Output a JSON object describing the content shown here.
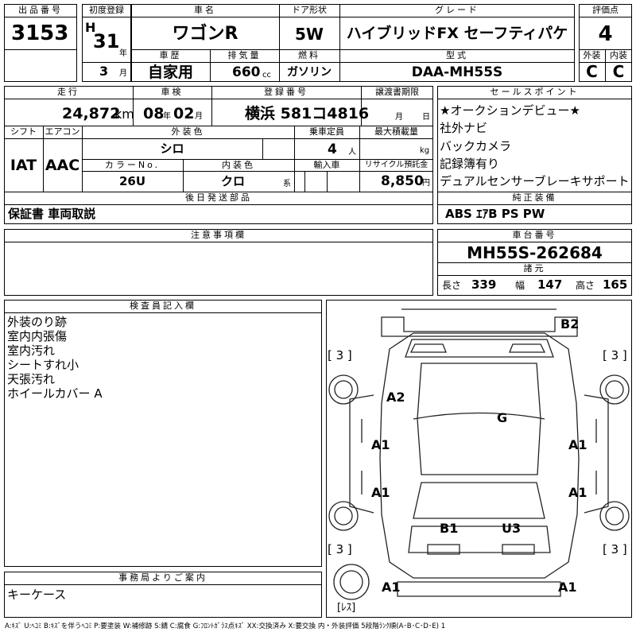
{
  "header": {
    "lot_no_label": "出品番号",
    "lot_no": "3153",
    "first_reg_label": "初度登録",
    "era": "H",
    "year": "31",
    "year_unit": "年",
    "month": "3",
    "month_unit": "月",
    "car_name_label": "車名",
    "car_name": "ワゴンR",
    "door_label": "ドア形状",
    "door": "5W",
    "grade_label": "グレード",
    "grade": "ハイブリッドFX セーフティパケ",
    "score_label": "評価点",
    "score": "4",
    "history_label": "車歴",
    "history": "自家用",
    "displacement_label": "排気量",
    "displacement": "660",
    "displacement_unit": "cc",
    "fuel_label": "燃料",
    "fuel": "ガソリン",
    "model_label": "型式",
    "model": "DAA-MH55S",
    "ext_label": "外装",
    "int_label": "内装",
    "ext_grade": "C",
    "int_grade": "C"
  },
  "row2": {
    "mileage_label": "走行",
    "mileage": "24,872",
    "mileage_unit": "km",
    "inspection_label": "車検",
    "insp_year": "08",
    "insp_year_unit": "年",
    "insp_month": "02",
    "insp_month_unit": "月",
    "plate_label": "登録番号",
    "plate": "横浜 581コ4816",
    "transfer_label": "譲渡書期限",
    "transfer_month_unit": "月",
    "transfer_day_unit": "日",
    "shift_label": "シフト",
    "shift": "IAT",
    "ac_label": "エアコン",
    "ac": "AAC",
    "color_label": "外装色",
    "color": "シロ",
    "capacity_label": "乗車定員",
    "capacity": "4",
    "capacity_unit": "人",
    "load_label": "最大積載量",
    "load_unit": "kg",
    "color_no_label": "カラーNo.",
    "color_no": "26U",
    "interior_color_label": "内装色",
    "interior_color": "クロ",
    "interior_color_unit": "系",
    "import_label": "輸入車",
    "recycle_label": "リサイクル預託金",
    "recycle": "8,850",
    "recycle_unit": "円"
  },
  "sales_points": {
    "label": "セールスポイント",
    "items": [
      "★オークションデビュー★",
      "社外ナビ",
      "バックカメラ",
      "記録簿有り",
      "デュアルセンサーブレーキサポート"
    ]
  },
  "later_parts": {
    "label": "後日発送部品",
    "value": "保証書 車両取説"
  },
  "genuine": {
    "label": "純正装備",
    "value": "ABS ｴｱB PS PW"
  },
  "caution": {
    "label": "注意事項欄"
  },
  "chassis": {
    "label": "車台番号",
    "value": "MH55S-262684"
  },
  "dims": {
    "label": "諸元",
    "length_label": "長さ",
    "length": "339",
    "width_label": "幅",
    "width": "147",
    "height_label": "高さ",
    "height": "165"
  },
  "inspector": {
    "label": "検査員記入欄",
    "lines": [
      "外装のり跡",
      "室内内張傷",
      "室内汚れ",
      "シートすれ小",
      "天張汚れ",
      "ホイールカバー A"
    ]
  },
  "office": {
    "label": "事務局よりご案内",
    "value": "キーケース"
  },
  "diagram_marks": {
    "rear": "B2",
    "tire_fl": "[ 3 ]",
    "tire_fr": "[ 3 ]",
    "tire_rl": "[ 3 ]",
    "tire_rr": "[ 3 ]",
    "a2": "A2",
    "g": "G",
    "a1_l1": "A1",
    "a1_r1": "A1",
    "a1_l2": "A1",
    "a1_r2": "A1",
    "b1": "B1",
    "u3": "U3",
    "a1_bl": "A1",
    "a1_br": "A1",
    "spare": "[ﾚｽ]"
  },
  "legend": "A:ｷｽﾞ U:ﾍｺﾐ B:ｷｽﾞを伴うﾍｺﾐ P:要塗装 W:補修跡 S:錆 C:腐食 G:ﾌﾛﾝﾄｶﾞﾗｽ点ｷｽﾞ XX:交換済み X:要交換 内・外装評価 5段階ﾗﾝｸ順(A･B･C･D･E) 1"
}
